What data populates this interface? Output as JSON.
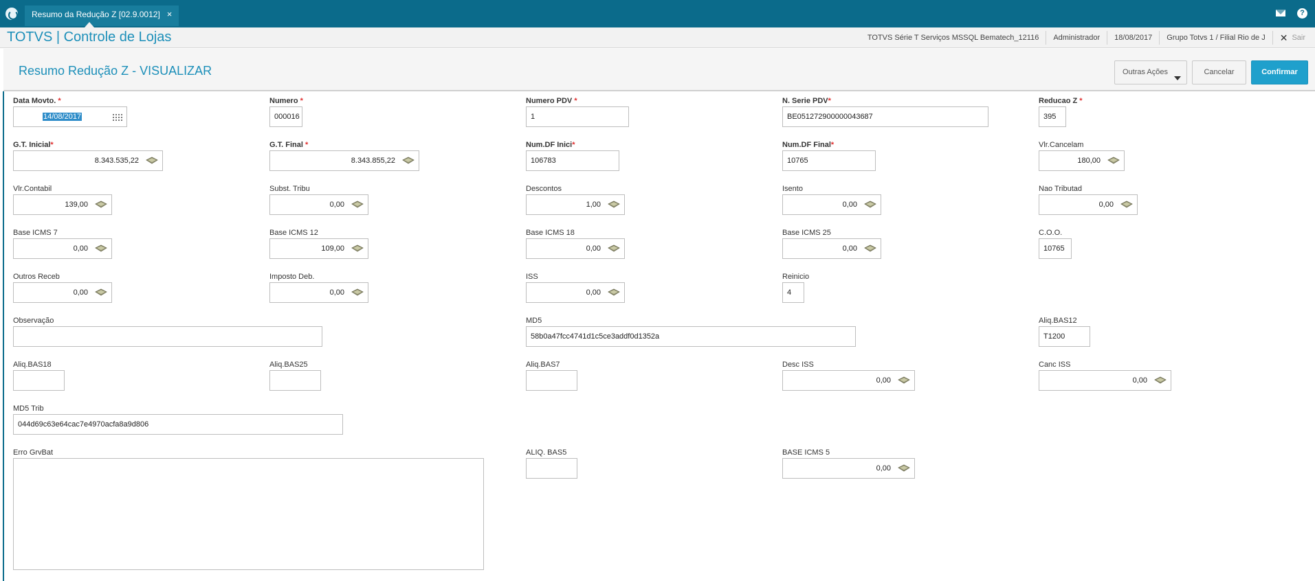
{
  "tab": {
    "title": "Resumo da Redução Z [02.9.0012]",
    "close": "×"
  },
  "app": {
    "title": "TOTVS | Controle de Lojas",
    "environment": "TOTVS Série T Serviços MSSQL Bematech_12116",
    "user": "Administrador",
    "date": "18/08/2017",
    "branch": "Grupo Totvs 1 / Filial Rio de J",
    "exit_x": "✕",
    "exit_label": "Sair"
  },
  "page": {
    "title": "Resumo Redução Z - VISUALIZAR",
    "btn_outras": "Outras Ações",
    "btn_cancel": "Cancelar",
    "btn_confirm": "Confirmar"
  },
  "fields": {
    "data_movto": {
      "label": "Data Movto.",
      "value": "14/08/2017"
    },
    "numero": {
      "label": "Numero",
      "value": "000016"
    },
    "numero_pdv": {
      "label": "Numero PDV",
      "value": "1"
    },
    "n_serie_pdv": {
      "label": "N. Serie PDV",
      "value": "BE051272900000043687"
    },
    "reducao_z": {
      "label": "Reducao Z",
      "value": "395"
    },
    "gt_inicial": {
      "label": "G.T. Inicial",
      "value": "8.343.535,22"
    },
    "gt_final": {
      "label": "G.T. Final",
      "value": "8.343.855,22"
    },
    "num_df_inici": {
      "label": "Num.DF Inici",
      "value": "106783"
    },
    "num_df_final": {
      "label": "Num.DF Final",
      "value": "10765"
    },
    "vlr_cancelam": {
      "label": "Vlr.Cancelam",
      "value": "180,00"
    },
    "vlr_contabil": {
      "label": "Vlr.Contabil",
      "value": "139,00"
    },
    "subst_tribu": {
      "label": "Subst. Tribu",
      "value": "0,00"
    },
    "descontos": {
      "label": "Descontos",
      "value": "1,00"
    },
    "isento": {
      "label": "Isento",
      "value": "0,00"
    },
    "nao_tributad": {
      "label": "Nao Tributad",
      "value": "0,00"
    },
    "base_icms_7": {
      "label": "Base ICMS 7",
      "value": "0,00"
    },
    "base_icms_12": {
      "label": "Base ICMS 12",
      "value": "109,00"
    },
    "base_icms_18": {
      "label": "Base ICMS 18",
      "value": "0,00"
    },
    "base_icms_25": {
      "label": "Base ICMS 25",
      "value": "0,00"
    },
    "coo": {
      "label": "C.O.O.",
      "value": "10765"
    },
    "outros_receb": {
      "label": "Outros Receb",
      "value": "0,00"
    },
    "imposto_deb": {
      "label": "Imposto Deb.",
      "value": "0,00"
    },
    "iss": {
      "label": "ISS",
      "value": "0,00"
    },
    "reinicio": {
      "label": "Reinicio",
      "value": "4"
    },
    "observacao": {
      "label": "Observação",
      "value": ""
    },
    "md5": {
      "label": "MD5",
      "value": "58b0a47fcc4741d1c5ce3addf0d1352a"
    },
    "aliq_bas12": {
      "label": "Aliq.BAS12",
      "value": "T1200"
    },
    "aliq_bas18": {
      "label": "Aliq.BAS18",
      "value": ""
    },
    "aliq_bas25": {
      "label": "Aliq.BAS25",
      "value": ""
    },
    "aliq_bas7": {
      "label": "Aliq.BAS7",
      "value": ""
    },
    "desc_iss": {
      "label": "Desc ISS",
      "value": "0,00"
    },
    "canc_iss": {
      "label": "Canc ISS",
      "value": "0,00"
    },
    "md5_trib": {
      "label": "MD5 Trib",
      "value": "044d69c63e64cac7e4970acfa8a9d806"
    },
    "erro_grvbat": {
      "label": "Erro GrvBat",
      "value": ""
    },
    "aliq_bas5": {
      "label": "ALIQ. BAS5",
      "value": ""
    },
    "base_icms_5": {
      "label": "BASE ICMS 5",
      "value": "0,00"
    }
  },
  "required_mark": "*"
}
